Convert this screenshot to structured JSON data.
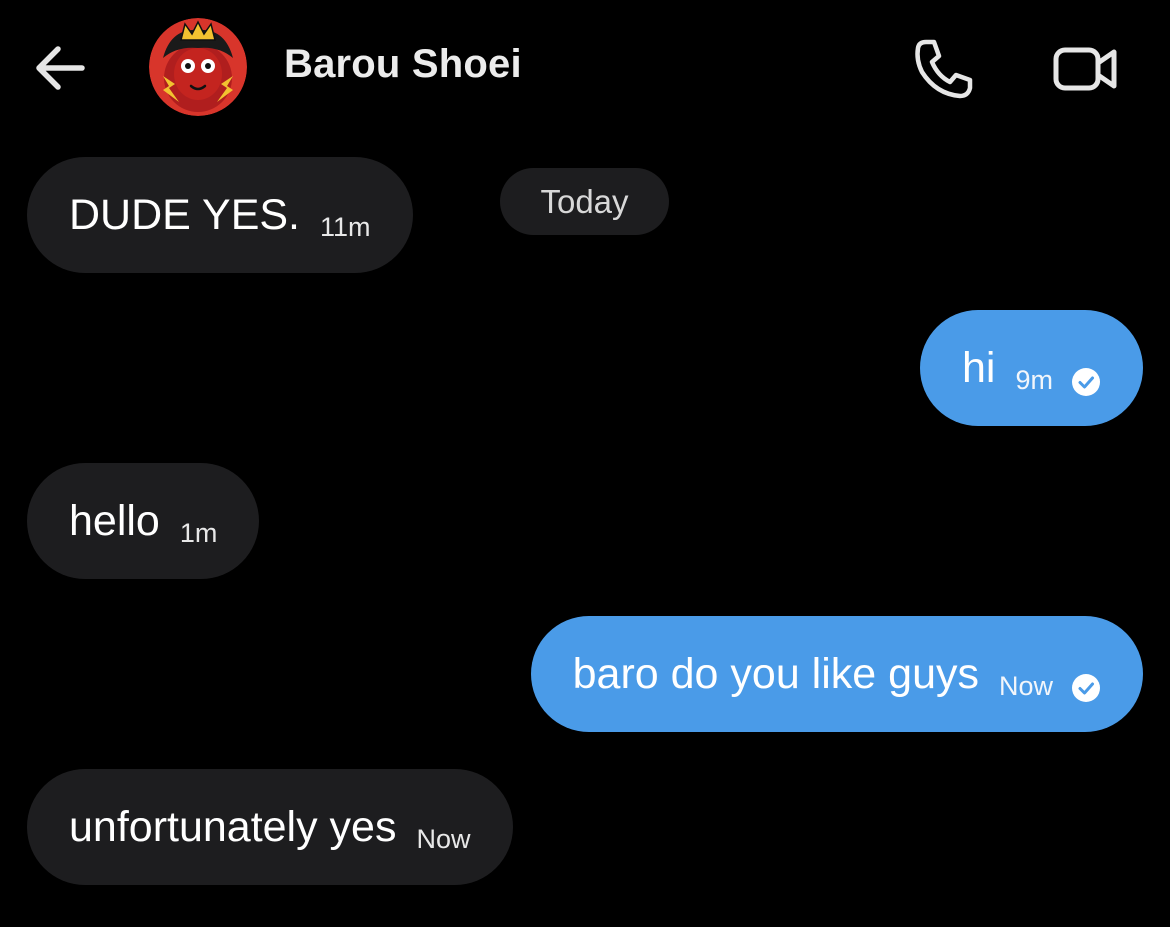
{
  "header": {
    "contact_name": "Barou Shoei",
    "back_icon": "arrow-left-icon",
    "call_icon": "phone-icon",
    "video_icon": "video-camera-icon"
  },
  "date_separator": "Today",
  "messages": [
    {
      "direction": "incoming",
      "text": "DUDE YES.",
      "time": "11m"
    },
    {
      "direction": "outgoing",
      "text": "hi",
      "time": "9m",
      "status_icon": "read-check-icon"
    },
    {
      "direction": "incoming",
      "text": "hello",
      "time": "1m"
    },
    {
      "direction": "outgoing",
      "text": "baro do you like guys",
      "time": "Now",
      "status_icon": "read-check-icon"
    },
    {
      "direction": "incoming",
      "text": "unfortunately yes",
      "time": "Now"
    }
  ],
  "colors": {
    "background": "#000000",
    "incoming_bubble": "#1d1d1f",
    "outgoing_bubble": "#4a9be8",
    "avatar_background": "#d8352b"
  }
}
